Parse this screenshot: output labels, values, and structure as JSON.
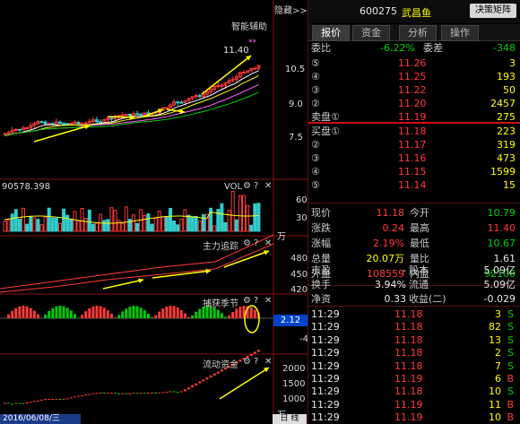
{
  "window": {
    "collapse_label": "隐藏>>",
    "smart_assist": "智能辅助",
    "date_label": "2016/06/08/三",
    "bottom_tab": "日 线",
    "unit_wan": "万",
    "unit_wan2": "万",
    "unit_wan3": "万"
  },
  "price_panel": {
    "high_label": "11.40",
    "scale": [
      "10.5",
      "9.0",
      "7.5"
    ]
  },
  "vol_panel": {
    "title": "VOL",
    "value": "90578.398",
    "scale": [
      "60",
      "30"
    ],
    "unit": "万"
  },
  "panel2": {
    "title": "主力追踪",
    "scale": [
      "480",
      "450",
      "420"
    ]
  },
  "panel3": {
    "title": "捕获季节",
    "current": "2.12",
    "scale": [
      "-4"
    ]
  },
  "panel4": {
    "title": "流动资金",
    "scale": [
      "2000",
      "1500",
      "1000"
    ]
  },
  "icons": {
    "gear": "⚙",
    "help": "?",
    "close": "✕"
  },
  "stock": {
    "code": "600275",
    "name": "武昌鱼",
    "btn_matrix": "决策矩阵"
  },
  "tabs": [
    "报价",
    "资金",
    "分析",
    "操作"
  ],
  "order": {
    "wb_label": "委比",
    "wb_value": "-6.22%",
    "wc_label": "委差",
    "wc_value": "-348"
  },
  "asks": [
    {
      "n": "⑤",
      "price": "11.26",
      "vol": "3"
    },
    {
      "n": "④",
      "price": "11.25",
      "vol": "193"
    },
    {
      "n": "③",
      "price": "11.22",
      "vol": "50"
    },
    {
      "n": "②",
      "price": "11.20",
      "vol": "2457"
    },
    {
      "n": "卖盘①",
      "price": "11.19",
      "vol": "275"
    }
  ],
  "bids": [
    {
      "n": "买盘①",
      "price": "11.18",
      "vol": "223"
    },
    {
      "n": "②",
      "price": "11.17",
      "vol": "319"
    },
    {
      "n": "③",
      "price": "11.16",
      "vol": "473"
    },
    {
      "n": "④",
      "price": "11.15",
      "vol": "1599"
    },
    {
      "n": "⑤",
      "price": "11.14",
      "vol": "15"
    }
  ],
  "quote": [
    [
      {
        "l": "现价",
        "v": "11.18",
        "c": "red"
      },
      {
        "l": "今开",
        "v": "10.79",
        "c": "green"
      }
    ],
    [
      {
        "l": "涨跌",
        "v": "0.24",
        "c": "red"
      },
      {
        "l": "最高",
        "v": "11.40",
        "c": "red"
      }
    ],
    [
      {
        "l": "涨幅",
        "v": "2.19%",
        "c": "red"
      },
      {
        "l": "最低",
        "v": "10.67",
        "c": "green"
      }
    ],
    [
      {
        "l": "总量",
        "v": "20.07万",
        "c": "yellow"
      },
      {
        "l": "量比",
        "v": "1.61",
        "c": "white"
      }
    ],
    [
      {
        "l": "外盘",
        "v": "108559",
        "c": "red"
      },
      {
        "l": "内盘",
        "v": "92106",
        "c": "green"
      }
    ]
  ],
  "fund": [
    [
      {
        "l": "市盈",
        "v": "-"
      },
      {
        "l": "股本",
        "v": "5.09亿"
      }
    ],
    [
      {
        "l": "换手",
        "v": "3.94%"
      },
      {
        "l": "流通",
        "v": "5.09亿"
      }
    ],
    [
      {
        "l": "净资",
        "v": "0.33"
      },
      {
        "l": "收益(二)",
        "v": "-0.029"
      }
    ]
  ],
  "ticks": [
    {
      "t": "11:29",
      "p": "11.18",
      "v": "3",
      "s": "S"
    },
    {
      "t": "11:29",
      "p": "11.18",
      "v": "82",
      "s": "S"
    },
    {
      "t": "11:29",
      "p": "11.18",
      "v": "13",
      "s": "S"
    },
    {
      "t": "11:29",
      "p": "11.18",
      "v": "2",
      "s": "S"
    },
    {
      "t": "11:29",
      "p": "11.18",
      "v": "7",
      "s": "S"
    },
    {
      "t": "11:29",
      "p": "11.19",
      "v": "6",
      "s": "B"
    },
    {
      "t": "11:29",
      "p": "11.18",
      "v": "10",
      "s": "S"
    },
    {
      "t": "11:29",
      "p": "11.19",
      "v": "11",
      "s": "B"
    },
    {
      "t": "11:29",
      "p": "11.19",
      "v": "10",
      "s": "B"
    }
  ],
  "colors": {
    "up": "#ff3a3a",
    "down": "#00d000",
    "accent": "#ffff00",
    "cyan": "#33cccc"
  }
}
